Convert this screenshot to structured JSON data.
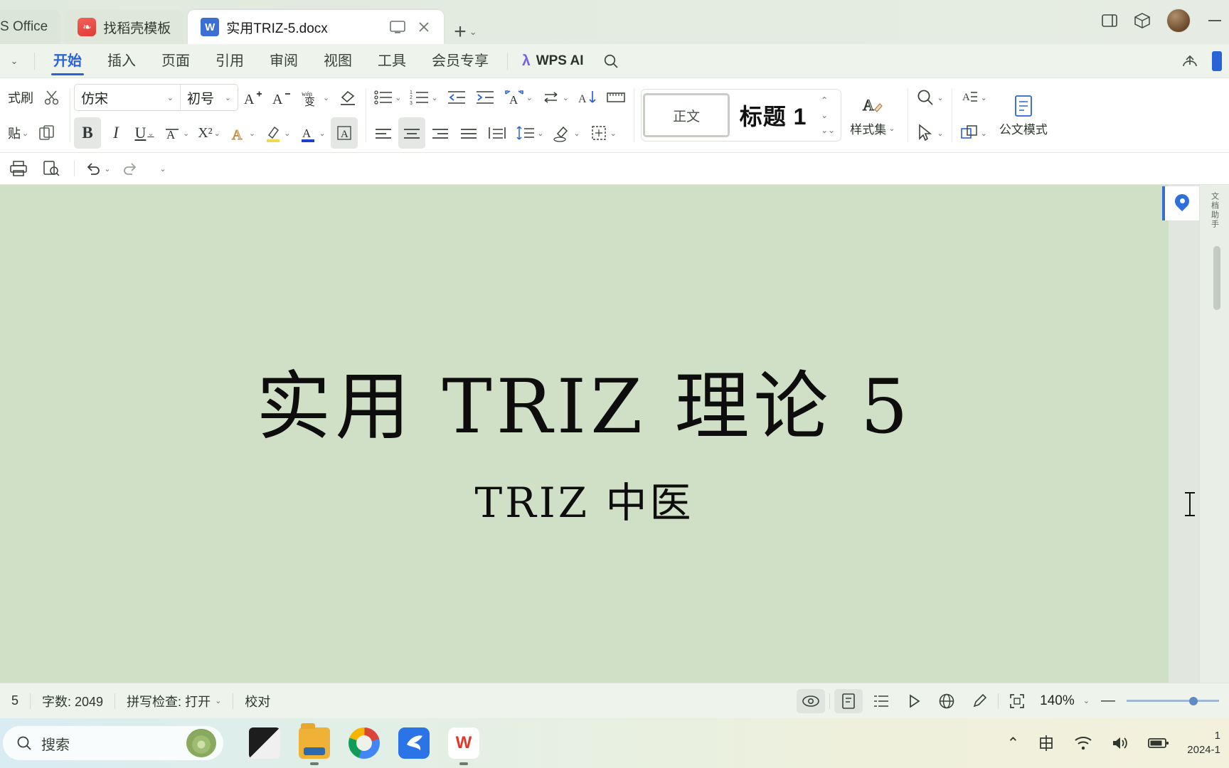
{
  "titlebar": {
    "tabs": [
      {
        "label": "S Office",
        "icon": "none"
      },
      {
        "label": "找稻壳模板",
        "icon": "docer-icon"
      },
      {
        "label": "实用TRIZ-5.docx",
        "icon": "word-doc-icon"
      }
    ],
    "tab_tools": {
      "present_label": "▭",
      "close_label": "✕"
    },
    "new_tab_label": "+",
    "window_controls": {
      "restore": "▭",
      "cube": "◫",
      "minimize": "—"
    }
  },
  "ribbon_tabs": {
    "collapse_label": "⌄",
    "items": [
      "开始",
      "插入",
      "页面",
      "引用",
      "审阅",
      "视图",
      "工具",
      "会员专享"
    ],
    "selected": "开始",
    "ai_label": "WPS AI",
    "search_label": "搜索"
  },
  "ribbon": {
    "clipboard": {
      "format_painter": "式刷",
      "cut": "剪切",
      "paste": "贴",
      "copy": "复制"
    },
    "font": {
      "name": "仿宋",
      "size": "初号",
      "grow_label": "A⁺",
      "shrink_label": "A⁻",
      "pinyin_label": "wén",
      "clear_format_label": "清除格式",
      "bold": "B",
      "italic": "I",
      "underline": "U",
      "strikethrough": "A",
      "superscript": "X²",
      "text_effect": "A",
      "highlight": "A",
      "font_color": "A",
      "char_shading": "A"
    },
    "paragraph": {
      "bullets": "项目符号",
      "numbering": "编号",
      "decrease_indent": "减少缩进",
      "increase_indent": "增加缩进",
      "pinyin_guide": "拼音指南",
      "change_case": "更改大小写",
      "sort": "排序",
      "show_marks": "显示段落标记",
      "align_left": "左对齐",
      "align_center": "居中",
      "align_right": "右对齐",
      "justify": "两端对齐",
      "distribute": "分散对齐",
      "line_spacing": "行距",
      "shading": "底纹",
      "borders": "边框"
    },
    "styles": {
      "items": [
        {
          "label": "正文",
          "selected": true
        },
        {
          "label": "标题 1",
          "selected": false
        }
      ],
      "gallery_up": "⌃",
      "gallery_down": "⌄",
      "gallery_more": "⌄⌄",
      "style_set_label": "样式集"
    },
    "find": {
      "find_label": "查找替换",
      "select_label": "选择"
    },
    "docmode": {
      "label": "公文模式",
      "sub": "文档"
    }
  },
  "quickbar": {
    "items": [
      {
        "name": "print",
        "label": "打印"
      },
      {
        "name": "print-preview",
        "label": "打印预览"
      },
      {
        "name": "undo",
        "label": "撤销"
      },
      {
        "name": "redo",
        "label": "恢复"
      },
      {
        "name": "more",
        "label": "更多"
      }
    ]
  },
  "document": {
    "title": "实用 TRIZ 理论 5",
    "subtitle": "TRIZ 中医"
  },
  "rail": {
    "pin_label": "定位",
    "side_text": "文档助手"
  },
  "statusbar": {
    "page_label": "5",
    "word_count": "字数: 2049",
    "spellcheck": "拼写检查: 打开",
    "proofread": "校对",
    "view_icons": [
      {
        "name": "eye-icon",
        "label": "全屏显示",
        "active": true
      },
      {
        "name": "page-view-icon",
        "label": "页面视图",
        "active": true
      },
      {
        "name": "outline-icon",
        "label": "大纲视图",
        "active": false
      },
      {
        "name": "play-icon",
        "label": "放映",
        "active": false
      },
      {
        "name": "web-icon",
        "label": "Web版式",
        "active": false
      },
      {
        "name": "pen-icon",
        "label": "写作模式",
        "active": false
      },
      {
        "name": "fit-icon",
        "label": "适合窗口",
        "active": false
      }
    ],
    "zoom": "140%",
    "zoom_out": "—",
    "zoom_in": "+"
  },
  "taskbar": {
    "search_placeholder": "搜索",
    "search_icon": "search-icon",
    "apps": [
      {
        "name": "task-view",
        "label": "任务视图",
        "running": false
      },
      {
        "name": "file-explorer",
        "label": "文件资源管理器",
        "running": true
      },
      {
        "name": "edge-browser",
        "label": "Microsoft Edge",
        "running": false
      },
      {
        "name": "qq-app",
        "label": "QQ",
        "running": false
      },
      {
        "name": "wps-office",
        "label": "WPS Office",
        "running": true
      }
    ],
    "tray": {
      "chevron": "⌃",
      "ime": "中",
      "wifi": "wifi-icon",
      "volume": "volume-icon",
      "battery": "battery-icon"
    },
    "clock": {
      "time": "1",
      "date": "2024-1"
    }
  },
  "colors": {
    "accent": "#2a62d8",
    "page_bg": "#cfe0c6",
    "ribbon_bg": "#ffffff",
    "chrome_bg": "#eef3ec"
  }
}
